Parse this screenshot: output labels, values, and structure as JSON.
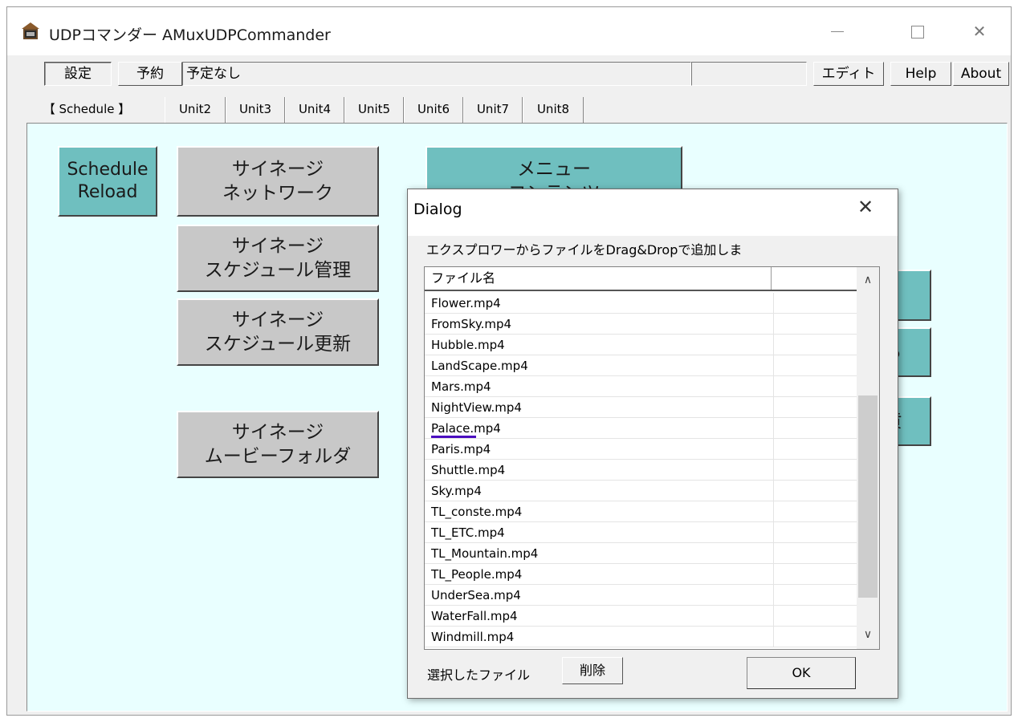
{
  "window": {
    "title": "UDPコマンダー AMuxUDPCommander",
    "controls": {
      "minimize": "—",
      "maximize": "",
      "close": "✕"
    }
  },
  "toolbar": {
    "settings": "設定",
    "reserve": "予約",
    "status": "予定なし",
    "status2": "",
    "edit": "エディト",
    "help": "Help",
    "about": "About"
  },
  "tabs": [
    {
      "label": "【 Schedule 】"
    },
    {
      "label": "Unit2"
    },
    {
      "label": "Unit3"
    },
    {
      "label": "Unit4"
    },
    {
      "label": "Unit5"
    },
    {
      "label": "Unit6"
    },
    {
      "label": "Unit7"
    },
    {
      "label": "Unit8"
    }
  ],
  "panel": {
    "schedule_reload": "Schedule\nReload",
    "signage_network": "サイネージ\nネットワーク",
    "menu_contents": "メニュー\nコンテンツ",
    "signage_schedule_manage": "サイネージ\nスケジュール管理",
    "signage_schedule_update": "サイネージ\nスケジュール更新",
    "signage_movie_folder": "サイネージ\nムービーフォルダ",
    "partial_btn_1": "",
    "partial_btn_2": "る",
    "partial_btn_3": "黄"
  },
  "dialog": {
    "title": "Dialog",
    "close": "✕",
    "instruction": "エクスプロワーからファイルをDrag&Dropで追加しま",
    "column_name": "ファイル名",
    "column_other": "",
    "files": [
      "Flower.mp4",
      "FromSky.mp4",
      "Hubble.mp4",
      "LandScape.mp4",
      "Mars.mp4",
      "NightView.mp4",
      "Palace.mp4",
      "Paris.mp4",
      "Shuttle.mp4",
      "Sky.mp4",
      "TL_conste.mp4",
      "TL_ETC.mp4",
      "TL_Mountain.mp4",
      "TL_People.mp4",
      "UnderSea.mp4",
      "WaterFall.mp4",
      "Windmill.mp4"
    ],
    "selected_label": "選択したファイル",
    "delete_label": "削除",
    "ok_label": "OK",
    "scroll_up": "∧",
    "scroll_down": "∨"
  }
}
